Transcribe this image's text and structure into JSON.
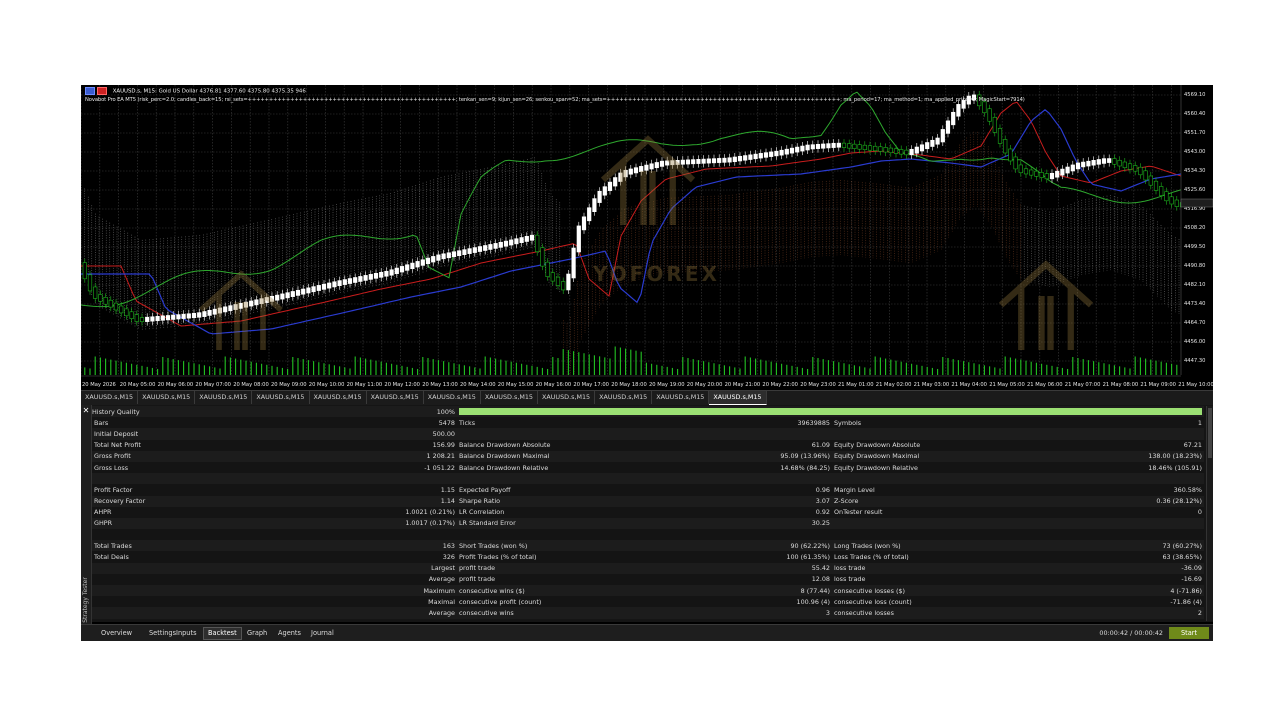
{
  "chart": {
    "symbol": "XAUUSD.s, M15:",
    "symbol_desc": "Gold US Dollar",
    "ohlc": "4376.81 4377.60 4375.80 4375.35",
    "tick_vol": "946",
    "ea_params": "Novabot Pro EA MT5 (risk_perc=2.0; candles_back=15; rsi_sets=+++++++++++++++++++++++++++++++++++++++++++++++++; tenkan_sen=9; kijun_sen=26; senkou_span=52; ma_sets=+++++++++++++++++++++++++++++++++++++++++++++++++++++++; ma_period=17; ma_method=1; ma_applied_price=5; MagicStart=7914)",
    "price_labels": [
      "4569.10",
      "4560.40",
      "4551.70",
      "4543.00",
      "4534.30",
      "4525.60",
      "4516.90",
      "4508.20",
      "4499.50",
      "4490.80",
      "4482.10",
      "4473.40",
      "4464.70",
      "4456.00",
      "4447.30"
    ],
    "time_labels": [
      "20 May 2026",
      "20 May 05:00",
      "20 May 06:00",
      "20 May 07:00",
      "20 May 08:00",
      "20 May 09:00",
      "20 May 10:00",
      "20 May 11:00",
      "20 May 12:00",
      "20 May 13:00",
      "20 May 14:00",
      "20 May 15:00",
      "20 May 16:00",
      "20 May 17:00",
      "20 May 18:00",
      "20 May 19:00",
      "20 May 20:00",
      "20 May 21:00",
      "20 May 22:00",
      "20 May 23:00",
      "21 May 01:00",
      "21 May 02:00",
      "21 May 03:00",
      "21 May 04:00",
      "21 May 05:00",
      "21 May 06:00",
      "21 May 07:00",
      "21 May 08:00",
      "21 May 09:00",
      "21 May 10:00"
    ],
    "watermark": "YOFOREX",
    "colors": {
      "bull": "#ffffff",
      "bear": "#1db31d",
      "ma_red": "#c81d1d",
      "kijun_blue": "#2a3bd0",
      "chikou_green": "#2ea82e",
      "cloud_white": "#d8d8d8",
      "cloud_orange": "#c0673a",
      "volume": "#22c322"
    }
  },
  "symbol_tabs": [
    "XAUUSD.s,M15",
    "XAUUSD.s,M15",
    "XAUUSD.s,M15",
    "XAUUSD.s,M15",
    "XAUUSD.s,M15",
    "XAUUSD.s,M15",
    "XAUUSD.s,M15",
    "XAUUSD.s,M15",
    "XAUUSD.s,M15",
    "XAUUSD.s,M15",
    "XAUUSD.s,M15",
    "XAUUSD.s,M15"
  ],
  "tester": {
    "side_label": "Strategy Tester",
    "history_quality": {
      "label": "History Quality",
      "value": "100%"
    },
    "rows": [
      [
        "Bars",
        "5478",
        "Ticks",
        "39639885",
        "Symbols",
        "1"
      ],
      [
        "Initial Deposit",
        "500.00",
        "",
        "",
        "",
        ""
      ],
      [
        "Total Net Profit",
        "156.99",
        "Balance Drawdown Absolute",
        "61.09",
        "Equity Drawdown Absolute",
        "67.21"
      ],
      [
        "Gross Profit",
        "1 208.21",
        "Balance Drawdown Maximal",
        "95.09 (13.96%)",
        "Equity Drawdown Maximal",
        "138.00 (18.23%)"
      ],
      [
        "Gross Loss",
        "-1 051.22",
        "Balance Drawdown Relative",
        "14.68% (84.25)",
        "Equity Drawdown Relative",
        "18.46% (105.91)"
      ],
      [
        "",
        "",
        "",
        "",
        "",
        ""
      ],
      [
        "Profit Factor",
        "1.15",
        "Expected Payoff",
        "0.96",
        "Margin Level",
        "360.58%"
      ],
      [
        "Recovery Factor",
        "1.14",
        "Sharpe Ratio",
        "3.07",
        "Z-Score",
        "0.36 (28.12%)"
      ],
      [
        "AHPR",
        "1.0021 (0.21%)",
        "LR Correlation",
        "0.92",
        "OnTester result",
        "0"
      ],
      [
        "GHPR",
        "1.0017 (0.17%)",
        "LR Standard Error",
        "30.25",
        "",
        ""
      ],
      [
        "",
        "",
        "",
        "",
        "",
        ""
      ],
      [
        "Total Trades",
        "163",
        "Short Trades (won %)",
        "90 (62.22%)",
        "Long Trades (won %)",
        "73 (60.27%)"
      ],
      [
        "Total Deals",
        "326",
        "Profit Trades (% of total)",
        "100 (61.35%)",
        "Loss Trades (% of total)",
        "63 (38.65%)"
      ],
      [
        "",
        "Largest",
        "profit trade",
        "55.42",
        "loss trade",
        "-36.09"
      ],
      [
        "",
        "Average",
        "profit trade",
        "12.08",
        "loss trade",
        "-16.69"
      ],
      [
        "",
        "Maximum",
        "consecutive wins ($)",
        "8 (77.44)",
        "consecutive losses ($)",
        "4 (-71.86)"
      ],
      [
        "",
        "Maximal",
        "consecutive profit (count)",
        "100.96 (4)",
        "consecutive loss (count)",
        "-71.86 (4)"
      ],
      [
        "",
        "Average",
        "consecutive wins",
        "3",
        "consecutive losses",
        "2"
      ]
    ]
  },
  "bottom_tabs": [
    "Overview",
    "Settings",
    "Inputs",
    "Backtest",
    "Graph",
    "Agents",
    "Journal"
  ],
  "active_bottom_tab": "Backtest",
  "timer": "00:00:42 / 00:00:42",
  "start_label": "Start"
}
